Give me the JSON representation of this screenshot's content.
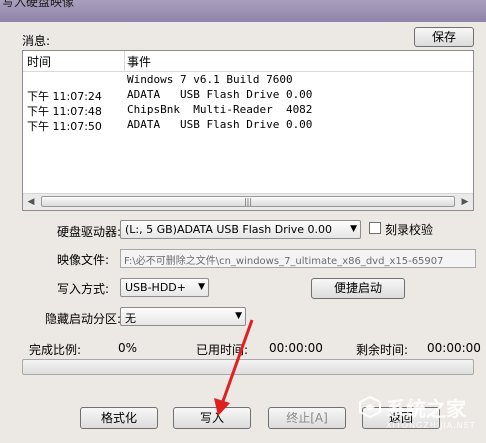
{
  "window": {
    "title": "写入硬盘映像"
  },
  "messages": {
    "label": "消息:",
    "save_button": "保存",
    "columns": [
      "时间",
      "事件"
    ],
    "rows": [
      {
        "time": "",
        "event": "Windows 7 v6.1 Build 7600"
      },
      {
        "time": "下午 11:07:24",
        "event": "ADATA   USB Flash Drive 0.00"
      },
      {
        "time": "下午 11:07:48",
        "event": "ChipsBnk  Multi-Reader  4082"
      },
      {
        "time": "下午 11:07:50",
        "event": "ADATA   USB Flash Drive 0.00"
      }
    ]
  },
  "form": {
    "drive_label": "硬盘驱动器:",
    "drive_value": "(L:, 5 GB)ADATA   USB Flash Drive 0.00",
    "verify_label": "刻录校验",
    "image_label": "映像文件:",
    "image_value": "F:\\必不可删除之文件\\cn_windows_7_ultimate_x86_dvd_x15-65907",
    "write_mode_label": "写入方式:",
    "write_mode_value": "USB-HDD+",
    "quick_boot_button": "便捷启动",
    "hidden_partition_label": "隐藏启动分区:",
    "hidden_partition_value": "无"
  },
  "progress": {
    "completed_label": "完成比例:",
    "completed_value": "0%",
    "elapsed_label": "已用时间:",
    "elapsed_value": "00:00:00",
    "remaining_label": "剩余时间:",
    "remaining_value": "00:00:00",
    "fraction": 0
  },
  "buttons": {
    "format": "格式化",
    "write": "写入",
    "stop": "终止[A]",
    "back": "返回"
  },
  "watermark": {
    "text": "系统之家",
    "url": "XITONGZHIJIA.NET"
  },
  "colors": {
    "annotation_arrow": "#e02020",
    "progress_fill": "#4cc44c"
  }
}
